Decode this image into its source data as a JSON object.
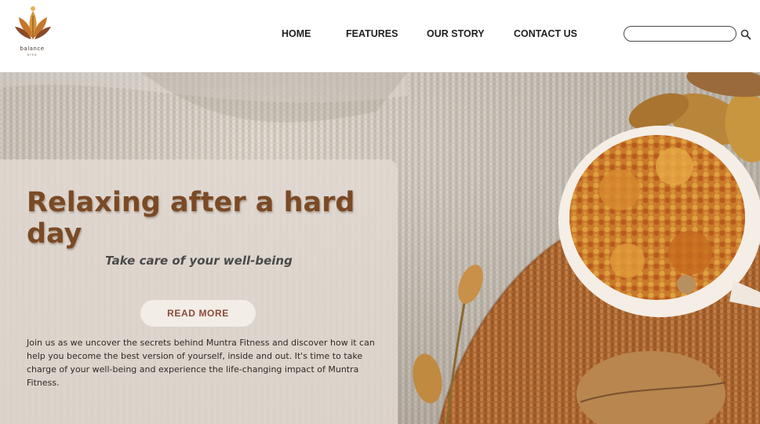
{
  "brand": {
    "name": "balance",
    "tagline": "area"
  },
  "nav": {
    "items": [
      {
        "label": "HOME"
      },
      {
        "label": "FEATURES"
      },
      {
        "label": "OUR STORY"
      },
      {
        "label": "CONTACT US"
      }
    ]
  },
  "search": {
    "value": "",
    "placeholder": "",
    "icon": "search-icon"
  },
  "hero": {
    "title": "Relaxing after a hard day",
    "subtitle": "Take care of your well-being",
    "button_label": "READ MORE",
    "body": "Join us as we uncover the secrets behind Muntra Fitness and discover how it can help you become the best version of yourself, inside and out. It's time to take charge of your well-being and experience the life-changing impact of Muntra Fitness."
  },
  "colors": {
    "title_brown": "#7a4a26",
    "button_text": "#8a4a3a",
    "card_overlay": "#e2dad2",
    "knit_orange": "#b8743a"
  }
}
